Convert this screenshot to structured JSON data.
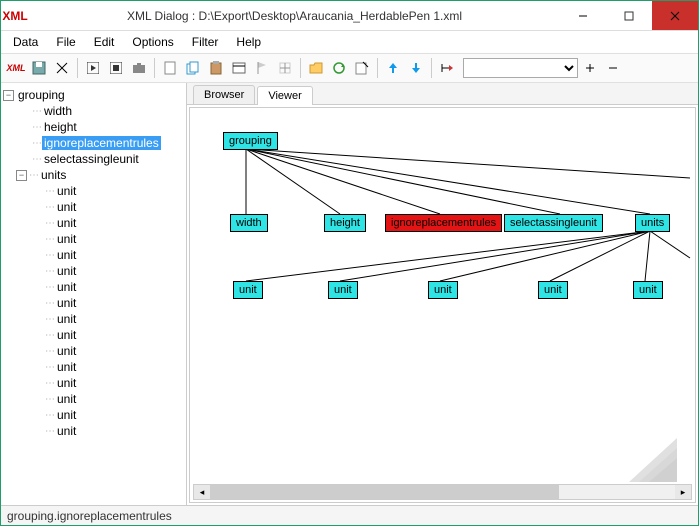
{
  "window": {
    "title": "XML Dialog : D:\\Export\\Desktop\\Araucania_HerdablePen 1.xml"
  },
  "menu": {
    "data": "Data",
    "file": "File",
    "edit": "Edit",
    "options": "Options",
    "filter": "Filter",
    "help": "Help"
  },
  "toolbar": {
    "xml": "XML"
  },
  "tree": {
    "root": "grouping",
    "children": [
      "width",
      "height",
      "ignoreplacementrules",
      "selectassingleunit"
    ],
    "units_label": "units",
    "unit_label": "unit",
    "unit_count": 16,
    "selected": "ignoreplacementrules"
  },
  "tabs": {
    "browser": "Browser",
    "viewer": "Viewer"
  },
  "graph": {
    "grouping": "grouping",
    "width": "width",
    "height": "height",
    "ignore": "ignoreplacementrules",
    "select": "selectassingleunit",
    "units": "units",
    "unit": "unit"
  },
  "status": {
    "path": "grouping.ignoreplacementrules"
  },
  "chart_data": {
    "type": "tree",
    "root": {
      "name": "grouping",
      "children": [
        {
          "name": "width"
        },
        {
          "name": "height"
        },
        {
          "name": "ignoreplacementrules",
          "selected": true
        },
        {
          "name": "selectassingleunit"
        },
        {
          "name": "units",
          "children": [
            {
              "name": "unit"
            },
            {
              "name": "unit"
            },
            {
              "name": "unit"
            },
            {
              "name": "unit"
            },
            {
              "name": "unit"
            },
            {
              "name": "unit"
            },
            {
              "name": "unit"
            },
            {
              "name": "unit"
            },
            {
              "name": "unit"
            },
            {
              "name": "unit"
            },
            {
              "name": "unit"
            },
            {
              "name": "unit"
            },
            {
              "name": "unit"
            },
            {
              "name": "unit"
            },
            {
              "name": "unit"
            },
            {
              "name": "unit"
            }
          ]
        }
      ]
    }
  }
}
